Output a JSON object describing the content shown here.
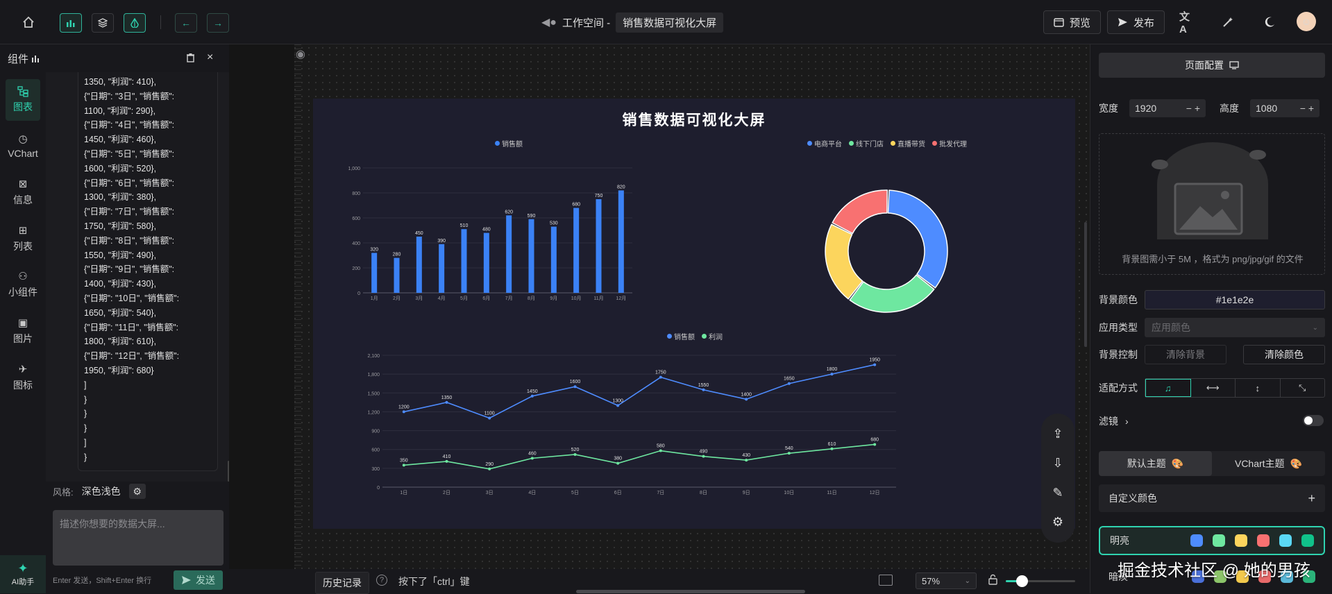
{
  "header": {
    "workspace_label": "工作空间 -",
    "project_name": "销售数据可视化大屏",
    "preview_label": "预览",
    "publish_label": "发布"
  },
  "left_panel": {
    "title": "组件",
    "rail": [
      {
        "label": "图表",
        "icon": "chart-tree-icon",
        "active": true
      },
      {
        "label": "VChart",
        "icon": "vchart-icon"
      },
      {
        "label": "信息",
        "icon": "info-icon"
      },
      {
        "label": "列表",
        "icon": "table-icon"
      },
      {
        "label": "小组件",
        "icon": "widget-icon"
      },
      {
        "label": "图片",
        "icon": "image-icon"
      },
      {
        "label": "图标",
        "icon": "icon-icon"
      }
    ],
    "code_lines": [
      "1350, \"利润\": 410},",
      "{\"日期\": \"3日\", \"销售额\":",
      "1100, \"利润\": 290},",
      "{\"日期\": \"4日\", \"销售额\":",
      "1450, \"利润\": 460},",
      "{\"日期\": \"5日\", \"销售额\":",
      "1600, \"利润\": 520},",
      "{\"日期\": \"6日\", \"销售额\":",
      "1300, \"利润\": 380},",
      "{\"日期\": \"7日\", \"销售额\":",
      "1750, \"利润\": 580},",
      "{\"日期\": \"8日\", \"销售额\":",
      "1550, \"利润\": 490},",
      "{\"日期\": \"9日\", \"销售额\":",
      "1400, \"利润\": 430},",
      "{\"日期\": \"10日\", \"销售额\":",
      "1650, \"利润\": 540},",
      "{\"日期\": \"11日\", \"销售额\":",
      "1800, \"利润\": 610},",
      "{\"日期\": \"12日\", \"销售额\":",
      "1950, \"利润\": 680}",
      "]",
      "}",
      "}",
      "}",
      "]",
      "}"
    ],
    "style_label": "风格:",
    "style_value": "深色浅色",
    "prompt_placeholder": "描述你想要的数据大屏...",
    "hint": "Enter 发送，Shift+Enter 换行",
    "send_label": "发送",
    "ai_label": "AI助手"
  },
  "canvas": {
    "title": "销售数据可视化大屏"
  },
  "chart_data": [
    {
      "type": "bar",
      "categories": [
        "1月",
        "2月",
        "3月",
        "4月",
        "5月",
        "6月",
        "7月",
        "8月",
        "9月",
        "10月",
        "11月",
        "12月"
      ],
      "series": [
        {
          "name": "销售额",
          "values": [
            320,
            280,
            450,
            390,
            510,
            480,
            620,
            590,
            530,
            680,
            750,
            820
          ],
          "color": "#3b82f6"
        }
      ],
      "ylim": [
        0,
        1000
      ],
      "yticks": [
        0,
        200,
        400,
        600,
        800,
        1000
      ],
      "ytick_labels": [
        "0",
        "200",
        "400",
        "600",
        "800",
        "1,000"
      ],
      "legend": "top"
    },
    {
      "type": "pie",
      "series": [
        {
          "name": "电商平台",
          "value": 35,
          "color": "#4e8cff"
        },
        {
          "name": "线下门店",
          "value": 25,
          "color": "#6ee7a0"
        },
        {
          "name": "直播带货",
          "value": 22,
          "color": "#fcd55d"
        },
        {
          "name": "批发代理",
          "value": 18,
          "color": "#f87171"
        }
      ],
      "donut": true,
      "legend": "top-right"
    },
    {
      "type": "line",
      "categories": [
        "1日",
        "2日",
        "3日",
        "4日",
        "5日",
        "6日",
        "7日",
        "8日",
        "9日",
        "10日",
        "11日",
        "12日"
      ],
      "series": [
        {
          "name": "销售额",
          "values": [
            1200,
            1350,
            1100,
            1450,
            1600,
            1300,
            1750,
            1550,
            1400,
            1650,
            1800,
            1950
          ],
          "color": "#4e8cff"
        },
        {
          "name": "利润",
          "values": [
            350,
            410,
            290,
            460,
            520,
            380,
            580,
            490,
            430,
            540,
            610,
            680
          ],
          "color": "#6ee7a0"
        }
      ],
      "ylim": [
        0,
        2100
      ],
      "yticks": [
        0,
        300,
        600,
        900,
        1200,
        1500,
        1800,
        2100
      ],
      "ytick_labels": [
        "0",
        "300",
        "600",
        "900",
        "1,200",
        "1,500",
        "1,800",
        "2,100"
      ],
      "legend": "top"
    }
  ],
  "bottom_bar": {
    "history_label": "历史记录",
    "status_text": "按下了「ctrl」键",
    "zoom": "57%",
    "zoom_level": 0.57
  },
  "right_panel": {
    "page_config_label": "页面配置",
    "width_label": "宽度",
    "width_value": "1920",
    "height_label": "高度",
    "height_value": "1080",
    "upload_hint": "背景图需小于 5M ，格式为 png/jpg/gif 的文件",
    "bg_color_label": "背景颜色",
    "bg_color_value": "#1e1e2e",
    "apply_type_label": "应用类型",
    "apply_type_value": "应用颜色",
    "bg_control_label": "背景控制",
    "clear_bg_label": "清除背景",
    "clear_color_label": "清除颜色",
    "fit_label": "适配方式",
    "filter_label": "滤镜",
    "theme_default": "默认主题",
    "theme_vchart": "VChart主题",
    "custom_color_label": "自定义颜色",
    "palette_light_label": "明亮",
    "palette_light": [
      "#4e8cff",
      "#6ee7a0",
      "#fcd55d",
      "#f87171",
      "#5ad8f5",
      "#10c28a"
    ],
    "palette_dark_label": "暗淡",
    "palette_dark": [
      "#4a6fd8",
      "#8cc46a",
      "#f2c94c",
      "#e86a6a",
      "#5ab8d8",
      "#2bb37a"
    ]
  },
  "watermark": "掘金技术社区 @ 她的男孩"
}
